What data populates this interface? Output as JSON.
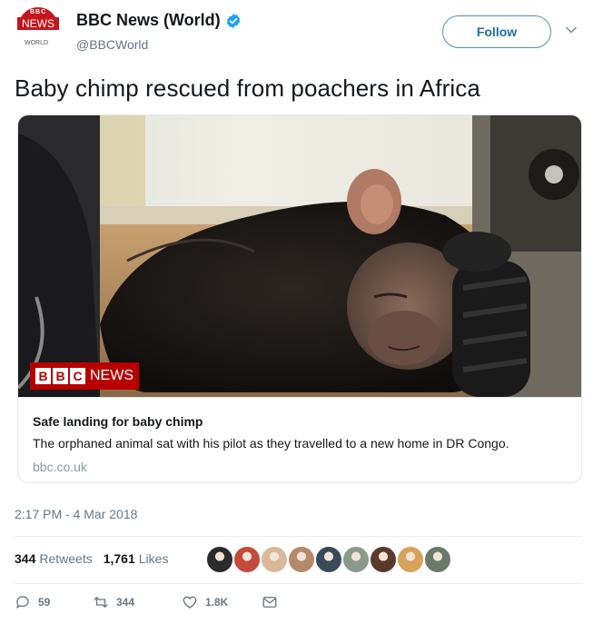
{
  "account": {
    "name": "BBC News (World)",
    "handle": "@BBCWorld",
    "avatar": {
      "top_text": "BBC",
      "main_text": "NEWS",
      "sub_text": "WORLD"
    },
    "verified_icon": "verified-badge-icon"
  },
  "follow_label": "Follow",
  "tweet_text": "Baby chimp rescued from poachers in Africa",
  "card": {
    "brand_letters": [
      "B",
      "B",
      "C"
    ],
    "brand_word": "NEWS",
    "title": "Safe landing for baby chimp",
    "description": "The orphaned animal sat with his pilot as they travelled to a new home in DR Congo.",
    "domain": "bbc.co.uk"
  },
  "timestamp": "2:17 PM - 4 Mar 2018",
  "stats": {
    "retweets_count": "344",
    "retweets_label": "Retweets",
    "likes_count": "1,761",
    "likes_label": "Likes"
  },
  "likers_count": 9,
  "actions": {
    "reply_count": "59",
    "retweet_count": "344",
    "like_count": "1.8K"
  },
  "colors": {
    "bbc_red": "#b80000",
    "link_blue": "#1da1f2",
    "muted_text": "#657786"
  }
}
